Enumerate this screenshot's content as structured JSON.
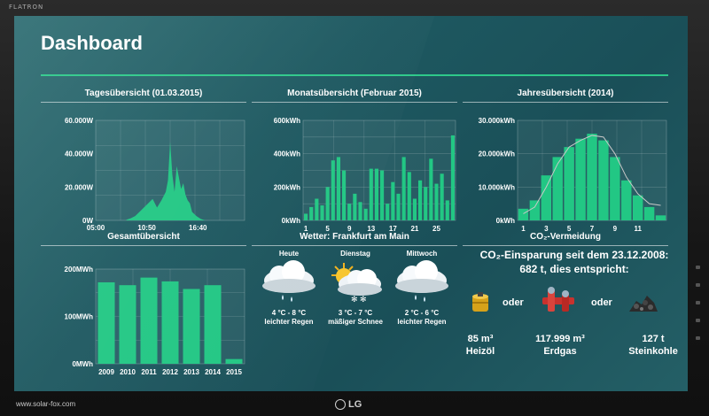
{
  "monitor": {
    "brand": "FLATRON",
    "logo_text": "LG",
    "footer_url": "www.solar-fox.com"
  },
  "dashboard": {
    "title": "Dashboard",
    "accent_color": "#2ec98a",
    "bar_color": "#22c784",
    "line_color": "#c8c8c8"
  },
  "panels": {
    "daily_title": "Tagesübersicht (01.03.2015)",
    "monthly_title": "Monatsübersicht (Februar 2015)",
    "yearly_title": "Jahresübersicht (2014)",
    "total_title": "Gesamtübersicht",
    "weather_title": "Wetter: Frankfurt am Main",
    "co2_title": "CO₂-Vermeidung"
  },
  "weather": {
    "days": [
      {
        "day": "Heute",
        "temp": "4 °C - 8 °C",
        "desc": "leichter Regen",
        "icon": "rain-cloud-icon"
      },
      {
        "day": "Dienstag",
        "temp": "3 °C - 7 °C",
        "desc": "mäßiger Schnee",
        "icon": "sun-snow-cloud-icon"
      },
      {
        "day": "Mittwoch",
        "temp": "2 °C - 6 °C",
        "desc": "leichter Regen",
        "icon": "rain-cloud-icon"
      }
    ]
  },
  "co2": {
    "headline_1": "CO₂-Einsparung seit dem 23.12.2008:",
    "headline_2": "682 t, dies entspricht:",
    "or_label": "oder",
    "items": [
      {
        "value": "85 m³",
        "label": "Heizöl",
        "icon": "oil-barrel-icon"
      },
      {
        "value": "117.999 m³",
        "label": "Erdgas",
        "icon": "gas-pipe-icon"
      },
      {
        "value": "127 t",
        "label": "Steinkohle",
        "icon": "coal-pile-icon"
      }
    ]
  },
  "chart_data": [
    {
      "type": "area",
      "title": "Tagesübersicht (01.03.2015)",
      "x_tick_labels": [
        "05:00",
        "10:50",
        "16:40"
      ],
      "y_tick_labels": [
        "0W",
        "20.000W",
        "40.000W",
        "60.000W"
      ],
      "ylim": [
        0,
        70000
      ],
      "x_hours": [
        8.5,
        9.0,
        9.5,
        10.0,
        10.5,
        11.0,
        11.5,
        12.0,
        12.5,
        13.0,
        13.25,
        13.5,
        13.75,
        14.0,
        14.25,
        14.5,
        14.75,
        15.0,
        15.25,
        15.5,
        15.75,
        16.0,
        16.5,
        17.0,
        17.5
      ],
      "values": [
        500,
        1500,
        3000,
        6000,
        9000,
        12000,
        15000,
        9000,
        14000,
        20000,
        28000,
        55000,
        32000,
        20000,
        38000,
        30000,
        22000,
        26000,
        18000,
        14000,
        12000,
        6000,
        3000,
        1000,
        0
      ],
      "xlim_hours": [
        5,
        22
      ]
    },
    {
      "type": "bar",
      "title": "Monatsübersicht (Februar 2015)",
      "x_tick_labels": [
        "1",
        "5",
        "9",
        "13",
        "17",
        "21",
        "25"
      ],
      "y_tick_labels": [
        "0kWh",
        "200kWh",
        "400kWh",
        "600kWh"
      ],
      "ylim": [
        0,
        600
      ],
      "values": [
        40,
        80,
        130,
        90,
        200,
        360,
        380,
        300,
        100,
        160,
        110,
        70,
        310,
        310,
        300,
        100,
        230,
        160,
        380,
        290,
        130,
        240,
        200,
        370,
        220,
        280,
        120,
        510
      ]
    },
    {
      "type": "bar",
      "title": "Jahresübersicht (2014)",
      "x_tick_labels": [
        "1",
        "3",
        "5",
        "7",
        "9",
        "11"
      ],
      "y_tick_labels": [
        "0kWh",
        "10.000kWh",
        "20.000kWh",
        "30.000kWh"
      ],
      "ylim": [
        0,
        30000
      ],
      "values": [
        3500,
        6000,
        13500,
        19000,
        22000,
        24500,
        26000,
        24000,
        19000,
        12000,
        7500,
        4000,
        1500
      ],
      "line_values": [
        2000,
        4000,
        10000,
        17000,
        22000,
        24000,
        25500,
        25000,
        20000,
        13000,
        8000,
        5000,
        4500
      ]
    },
    {
      "type": "bar",
      "title": "Gesamtübersicht",
      "categories": [
        "2009",
        "2010",
        "2011",
        "2012",
        "2013",
        "2014",
        "2015"
      ],
      "y_tick_labels": [
        "0MWh",
        "100MWh",
        "200MWh"
      ],
      "ylim": [
        0,
        200
      ],
      "values": [
        172,
        166,
        182,
        174,
        158,
        166,
        10
      ]
    }
  ]
}
